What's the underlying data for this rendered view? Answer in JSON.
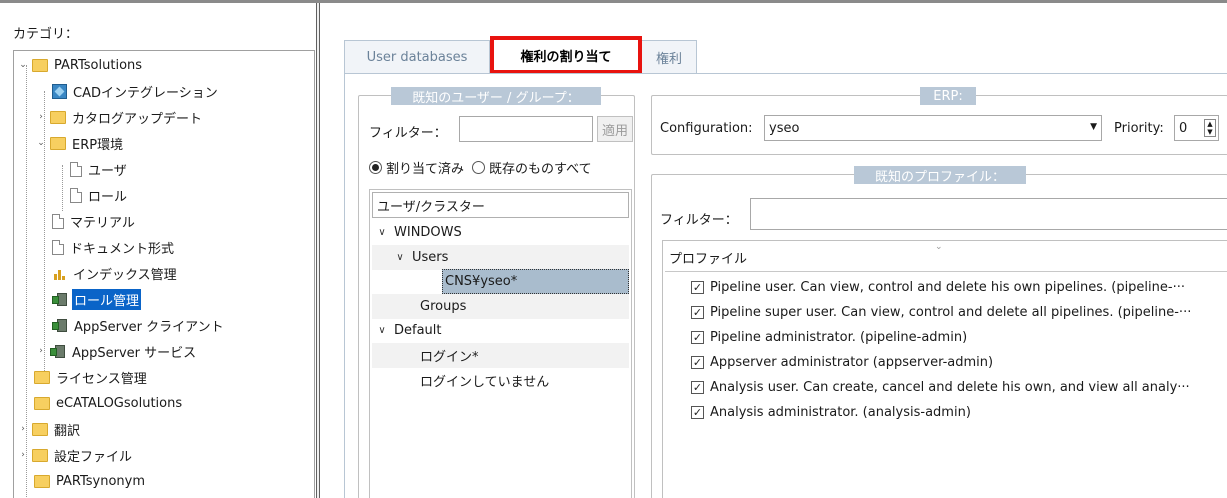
{
  "left_panel": {
    "category_label": "カテゴリ：",
    "tree": [
      {
        "label": "PARTsolutions",
        "icon": "folder-icon"
      },
      {
        "label": "CADインテグレーション",
        "icon": "cad-icon"
      },
      {
        "label": "カタログアップデート",
        "icon": "folder-icon"
      },
      {
        "label": "ERP環境",
        "icon": "folder-icon"
      },
      {
        "label": "ユーザ",
        "icon": "document-icon"
      },
      {
        "label": "ロール",
        "icon": "document-icon"
      },
      {
        "label": "マテリアル",
        "icon": "document-icon"
      },
      {
        "label": "ドキュメント形式",
        "icon": "document-icon"
      },
      {
        "label": "インデックス管理",
        "icon": "index-icon"
      },
      {
        "label": "ロール管理",
        "icon": "role-icon",
        "selected": true
      },
      {
        "label": "AppServer クライアント",
        "icon": "role-icon"
      },
      {
        "label": "AppServer サービス",
        "icon": "role-icon"
      },
      {
        "label": "ライセンス管理",
        "icon": "folder-icon"
      },
      {
        "label": "eCATALOGsolutions",
        "icon": "folder-icon"
      },
      {
        "label": "翻訳",
        "icon": "folder-icon"
      },
      {
        "label": "設定ファイル",
        "icon": "folder-icon"
      },
      {
        "label": "PARTsynonym",
        "icon": "folder-icon"
      }
    ]
  },
  "tabs": [
    {
      "label": "User databases"
    },
    {
      "label": "権利の割り当て",
      "active": true
    },
    {
      "label": "権利"
    }
  ],
  "users_group": {
    "title": "既知のユーザー / グループ：",
    "filter_label": "フィルター：",
    "filter_value": "",
    "apply_button": "適用",
    "radio_assigned": "割り当て済み",
    "radio_all": "既存のものすべて",
    "list_header": "ユーザ/クラスター",
    "items": [
      {
        "label": "WINDOWS",
        "chevron": "∨"
      },
      {
        "label": "Users",
        "chevron": "∨"
      },
      {
        "label": "CNS¥yseo*"
      },
      {
        "label": "Groups"
      },
      {
        "label": "Default",
        "chevron": "∨"
      },
      {
        "label": "ログイン*"
      },
      {
        "label": "ログインしていません"
      }
    ]
  },
  "erp_group": {
    "title": "ERP:",
    "configuration_label": "Configuration:",
    "configuration_value": "yseo",
    "priority_label": "Priority:",
    "priority_value": "0"
  },
  "profiles_group": {
    "title": "既知のプロファイル：",
    "filter_label": "フィルター：",
    "filter_value": "",
    "list_header": "プロファイル",
    "profiles": [
      {
        "label": "Pipeline user. Can view, control and delete his own pipelines. (pipeline-···",
        "checked": true
      },
      {
        "label": "Pipeline super user. Can view, control and delete all pipelines. (pipeline-···",
        "checked": true
      },
      {
        "label": "Pipeline administrator. (pipeline-admin)",
        "checked": true
      },
      {
        "label": "Appserver administrator (appserver-admin)",
        "checked": true
      },
      {
        "label": "Analysis user. Can create, cancel and delete his own, and view all analy···",
        "checked": true
      },
      {
        "label": "Analysis administrator. (analysis-admin)",
        "checked": true
      }
    ]
  },
  "colors": {
    "highlight_border": "#e8130f",
    "selection": "#0a64c8",
    "group_title_bg": "#b9c8d7",
    "list_selection": "#a9bccd"
  }
}
